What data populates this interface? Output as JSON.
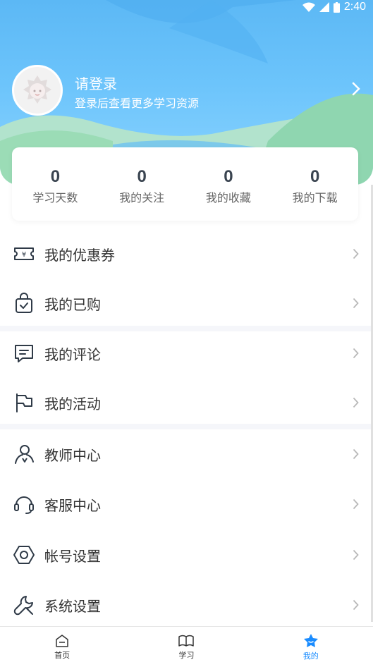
{
  "status": {
    "time": "2:40"
  },
  "profile": {
    "title": "请登录",
    "subtitle": "登录后查看更多学习资源"
  },
  "stats": [
    {
      "value": "0",
      "label": "学习天数"
    },
    {
      "value": "0",
      "label": "我的关注"
    },
    {
      "value": "0",
      "label": "我的收藏"
    },
    {
      "value": "0",
      "label": "我的下载"
    }
  ],
  "menu": {
    "coupons": "我的优惠券",
    "purchased": "我的已购",
    "comments": "我的评论",
    "activities": "我的活动",
    "teacher": "教师中心",
    "service": "客服中心",
    "account": "帐号设置",
    "system": "系统设置"
  },
  "tabs": [
    {
      "label": "首页"
    },
    {
      "label": "学习"
    },
    {
      "label": "我的"
    }
  ],
  "colors": {
    "accent": "#1a8cff",
    "hero": "#6cc4fb"
  }
}
